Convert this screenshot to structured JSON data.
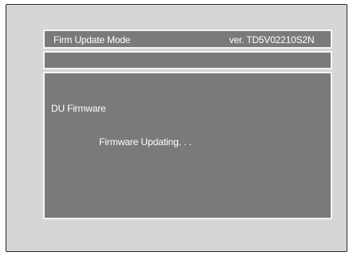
{
  "header": {
    "title": "Firm Update Mode",
    "version": "ver.  TD5V02210S2N"
  },
  "content": {
    "component": "DU Firmware",
    "status": "Firmware Updating. . ."
  },
  "colors": {
    "screen_background": "#d6d6d6",
    "panel_fill": "#7a7a7a",
    "panel_border": "#f4f4f4",
    "text": "#ffffff"
  }
}
